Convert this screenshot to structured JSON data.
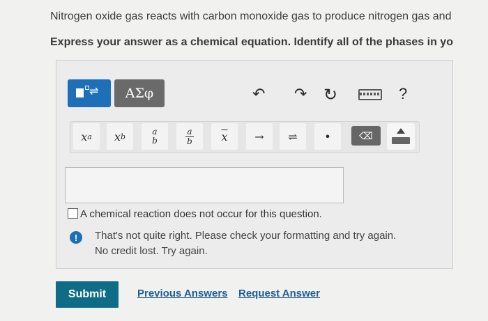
{
  "question": {
    "text": "Nitrogen oxide gas reacts with carbon monoxide gas to produce nitrogen gas and",
    "instruction": "Express your answer as a chemical equation. Identify all of the phases in yo"
  },
  "toolbar": {
    "greek_label": "ΑΣφ",
    "undo_icon": "↶",
    "redo_icon": "↷",
    "reset_icon": "↻",
    "help_label": "?"
  },
  "math_toolbar": {
    "superscript_base": "x",
    "superscript_exp": "a",
    "subscript_base": "x",
    "subscript_sub": "b",
    "fraction_num": "a",
    "fraction_den": "b",
    "mixed_num": "a",
    "mixed_den": "b",
    "vector_label": "x",
    "arrow_label": "→",
    "equilibrium_label": "⇌",
    "dot_label": "•",
    "delete_label": "⌫"
  },
  "answer": {
    "value": ""
  },
  "checkbox": {
    "label": "A chemical reaction does not occur for this question.",
    "checked": false
  },
  "feedback": {
    "icon": "!",
    "line1": "That's not quite right. Please check your formatting and try again.",
    "line2": "No credit lost. Try again."
  },
  "actions": {
    "submit_label": "Submit",
    "previous_answers_label": "Previous Answers",
    "request_answer_label": "Request Answer"
  }
}
